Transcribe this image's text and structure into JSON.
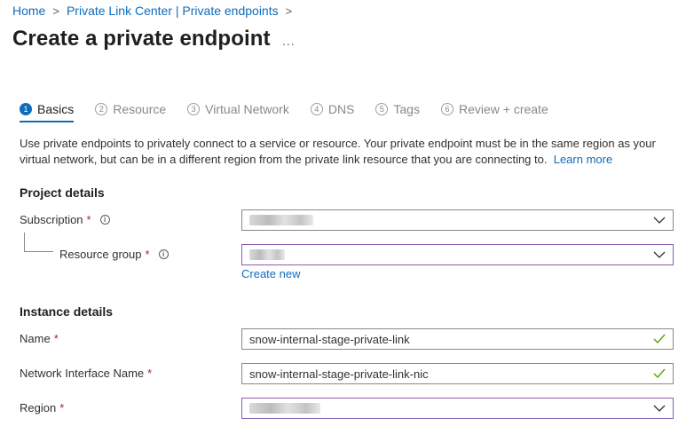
{
  "breadcrumb": {
    "home": "Home",
    "private_link": "Private Link Center | Private endpoints",
    "sep": ">"
  },
  "page": {
    "title": "Create a private endpoint",
    "more": "..."
  },
  "steps": [
    {
      "num": "1",
      "label": "Basics",
      "active": true
    },
    {
      "num": "2",
      "label": "Resource"
    },
    {
      "num": "3",
      "label": "Virtual Network"
    },
    {
      "num": "4",
      "label": "DNS"
    },
    {
      "num": "5",
      "label": "Tags"
    },
    {
      "num": "6",
      "label": "Review + create"
    }
  ],
  "description": {
    "text": "Use private endpoints to privately connect to a service or resource. Your private endpoint must be in the same region as your virtual network, but can be in a different region from the private link resource that you are connecting to.",
    "learn_more": "Learn more"
  },
  "project": {
    "heading": "Project details",
    "subscription_label": "Subscription",
    "resource_group_label": "Resource group",
    "create_new": "Create new"
  },
  "instance": {
    "heading": "Instance details",
    "name_label": "Name",
    "name_value": "snow-internal-stage-private-link",
    "nic_label": "Network Interface Name",
    "nic_value": "snow-internal-stage-private-link-nic",
    "region_label": "Region"
  },
  "required_mark": "*",
  "info_mark": "i",
  "colors": {
    "accent": "#0f6cbd",
    "required": "#a4262c",
    "valid": "#57a300",
    "focus_border": "#8a5fb1"
  }
}
